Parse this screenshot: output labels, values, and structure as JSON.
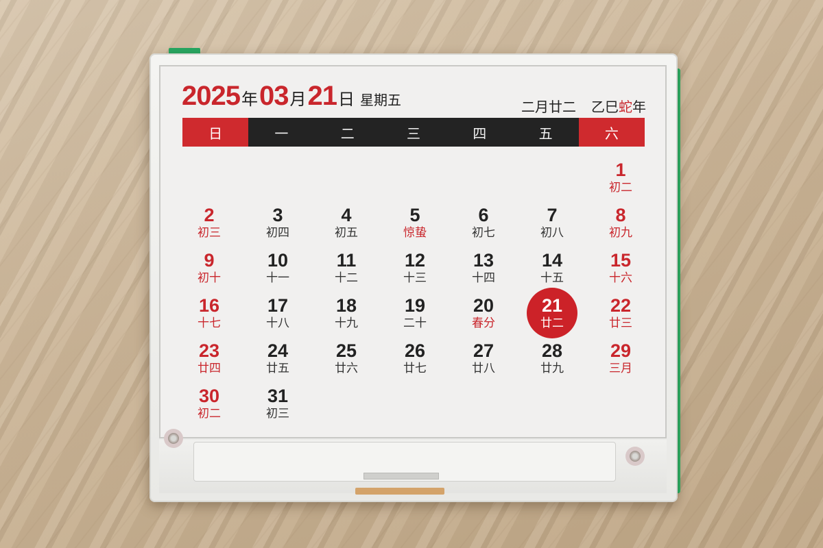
{
  "header": {
    "year": "2025",
    "year_unit": "年",
    "month": "03",
    "month_unit": "月",
    "day": "21",
    "day_unit": "日",
    "weekday": "星期五",
    "lunar_date": "二月廿二",
    "ganzhi_prefix": "乙巳",
    "zodiac": "蛇",
    "ganzhi_suffix": "年"
  },
  "weekdays": [
    "日",
    "一",
    "二",
    "三",
    "四",
    "五",
    "六"
  ],
  "colors": {
    "accent_red": "#c9262c",
    "bar_dark": "#232323"
  },
  "weeks": [
    [
      {
        "day": "",
        "lunar": ""
      },
      {
        "day": "",
        "lunar": ""
      },
      {
        "day": "",
        "lunar": ""
      },
      {
        "day": "",
        "lunar": ""
      },
      {
        "day": "",
        "lunar": ""
      },
      {
        "day": "",
        "lunar": ""
      },
      {
        "day": "1",
        "lunar": "初二"
      }
    ],
    [
      {
        "day": "2",
        "lunar": "初三"
      },
      {
        "day": "3",
        "lunar": "初四"
      },
      {
        "day": "4",
        "lunar": "初五"
      },
      {
        "day": "5",
        "lunar": "惊蛰"
      },
      {
        "day": "6",
        "lunar": "初七"
      },
      {
        "day": "7",
        "lunar": "初八"
      },
      {
        "day": "8",
        "lunar": "初九"
      }
    ],
    [
      {
        "day": "9",
        "lunar": "初十"
      },
      {
        "day": "10",
        "lunar": "十一"
      },
      {
        "day": "11",
        "lunar": "十二"
      },
      {
        "day": "12",
        "lunar": "十三"
      },
      {
        "day": "13",
        "lunar": "十四"
      },
      {
        "day": "14",
        "lunar": "十五"
      },
      {
        "day": "15",
        "lunar": "十六"
      }
    ],
    [
      {
        "day": "16",
        "lunar": "十七"
      },
      {
        "day": "17",
        "lunar": "十八"
      },
      {
        "day": "18",
        "lunar": "十九"
      },
      {
        "day": "19",
        "lunar": "二十"
      },
      {
        "day": "20",
        "lunar": "春分"
      },
      {
        "day": "21",
        "lunar": "廿二"
      },
      {
        "day": "22",
        "lunar": "廿三"
      }
    ],
    [
      {
        "day": "23",
        "lunar": "廿四"
      },
      {
        "day": "24",
        "lunar": "廿五"
      },
      {
        "day": "25",
        "lunar": "廿六"
      },
      {
        "day": "26",
        "lunar": "廿七"
      },
      {
        "day": "27",
        "lunar": "廿八"
      },
      {
        "day": "28",
        "lunar": "廿九"
      },
      {
        "day": "29",
        "lunar": "三月"
      }
    ],
    [
      {
        "day": "30",
        "lunar": "初二"
      },
      {
        "day": "31",
        "lunar": "初三"
      },
      {
        "day": "",
        "lunar": ""
      },
      {
        "day": "",
        "lunar": ""
      },
      {
        "day": "",
        "lunar": ""
      },
      {
        "day": "",
        "lunar": ""
      },
      {
        "day": "",
        "lunar": ""
      }
    ]
  ],
  "today": "21",
  "solar_terms": [
    "惊蛰",
    "春分"
  ]
}
